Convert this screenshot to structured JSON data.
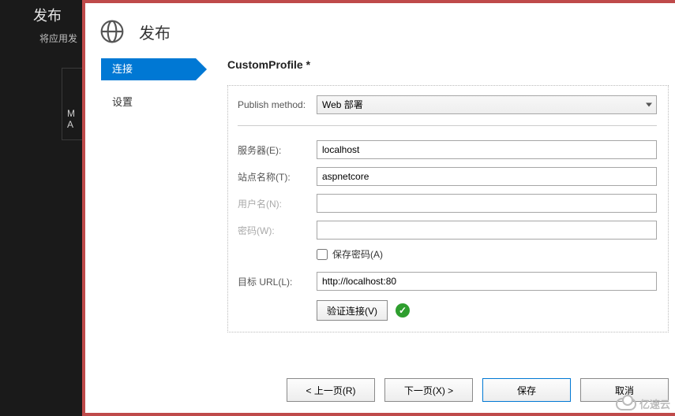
{
  "background": {
    "title": "发布",
    "subtitle": "将应用发",
    "box_line1": "M",
    "box_line2": "A"
  },
  "dialog": {
    "title": "发布",
    "nav": {
      "connection": "连接",
      "settings": "设置"
    },
    "profile_title": "CustomProfile *",
    "labels": {
      "publish_method": "Publish method:",
      "server": "服务器(E):",
      "site_name": "站点名称(T):",
      "username": "用户名(N):",
      "password": "密码(W):",
      "save_password": "保存密码(A)",
      "dest_url": "目标 URL(L):",
      "validate": "验证连接(V)"
    },
    "values": {
      "publish_method": "Web 部署",
      "server": "localhost",
      "site_name": "aspnetcore",
      "username": "",
      "password": "",
      "save_password_checked": false,
      "dest_url": "http://localhost:80",
      "validation_ok": true
    },
    "footer": {
      "prev": "< 上一页(R)",
      "next": "下一页(X) >",
      "save": "保存",
      "cancel": "取消"
    }
  },
  "watermark": "亿速云"
}
